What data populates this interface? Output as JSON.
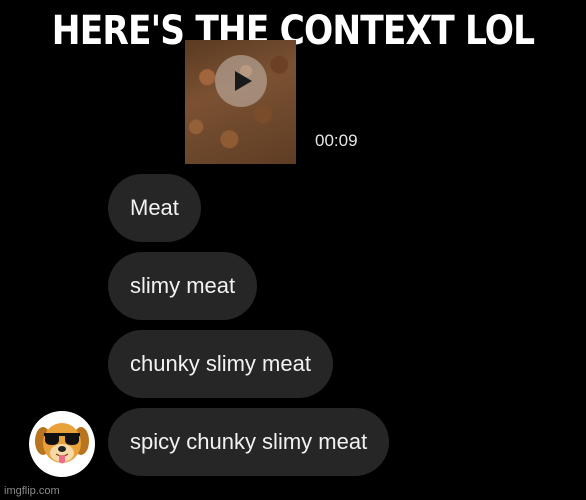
{
  "meme": {
    "caption": "HERE'S THE CONTEXT LOL"
  },
  "video_message": {
    "duration": "00:09",
    "play_icon": "play-icon"
  },
  "messages": [
    {
      "text": "Meat"
    },
    {
      "text": "slimy meat"
    },
    {
      "text": "chunky slimy meat"
    },
    {
      "text": "spicy chunky slimy meat"
    }
  ],
  "sender": {
    "avatar_icon": "dog-sunglasses-avatar"
  },
  "watermark": "imgflip.com",
  "colors": {
    "background": "#000000",
    "bubble": "#262626",
    "text": "#f2f2f2"
  }
}
